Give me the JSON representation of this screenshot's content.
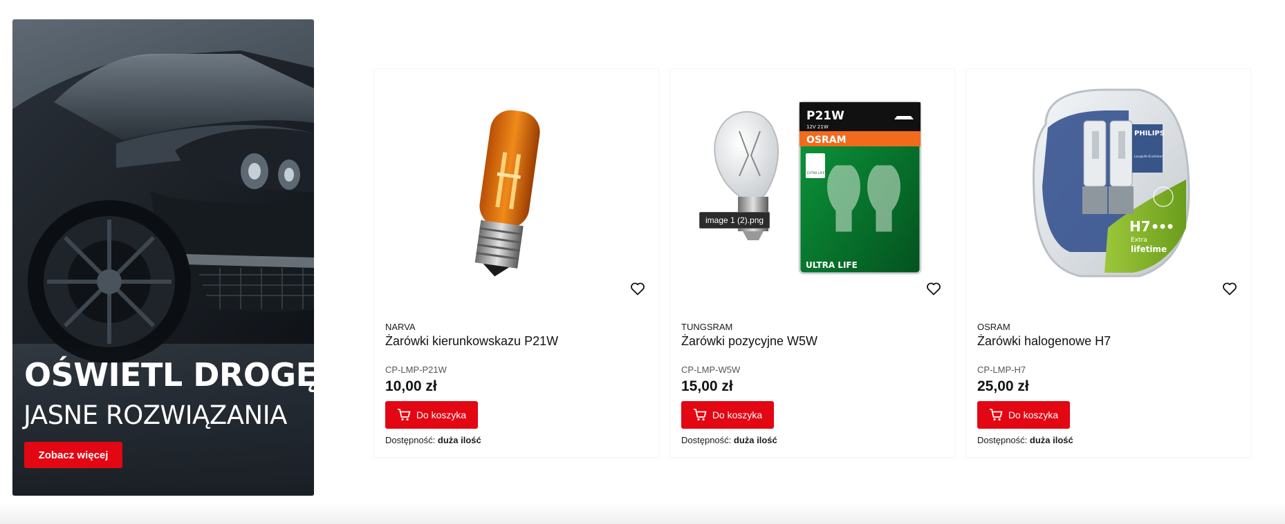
{
  "banner": {
    "title": "OŚWIETL DROGĘ!",
    "subtitle": "JASNE ROZWIĄZANIA",
    "cta": "Zobacz więcej"
  },
  "products": [
    {
      "brand": "NARVA",
      "name": "Żarówki kierunkowskazu P21W",
      "sku": "CP-LMP-P21W",
      "price": "10,00 zł",
      "cart_label": "Do koszyka",
      "availability_label": "Dostępność:",
      "availability_value": "duża ilość"
    },
    {
      "brand": "TUNGSRAM",
      "name": "Żarówki pozycyjne W5W",
      "sku": "CP-LMP-W5W",
      "price": "15,00 zł",
      "cart_label": "Do koszyka",
      "availability_label": "Dostępność:",
      "availability_value": "duża ilość",
      "image_tooltip": "image 1 (2).png",
      "package": {
        "code": "P21W",
        "spec": "12V 21W",
        "brand": "OSRAM",
        "line": "ULTRA LIFE",
        "badge": "EXTRA LIFETIME"
      }
    },
    {
      "brand": "OSRAM",
      "name": "Żarówki halogenowe H7",
      "sku": "CP-LMP-H7",
      "price": "25,00 zł",
      "cart_label": "Do koszyka",
      "availability_label": "Dostępność:",
      "availability_value": "duża ilość",
      "package": {
        "brand": "PHILIPS",
        "line": "LongLife EcoVision",
        "code": "H7",
        "tag1": "Extra",
        "tag2": "lifetime"
      }
    }
  ],
  "colors": {
    "accent": "#e30613"
  },
  "icons": {
    "favorite": "heart-outline-icon",
    "cart": "cart-icon"
  }
}
